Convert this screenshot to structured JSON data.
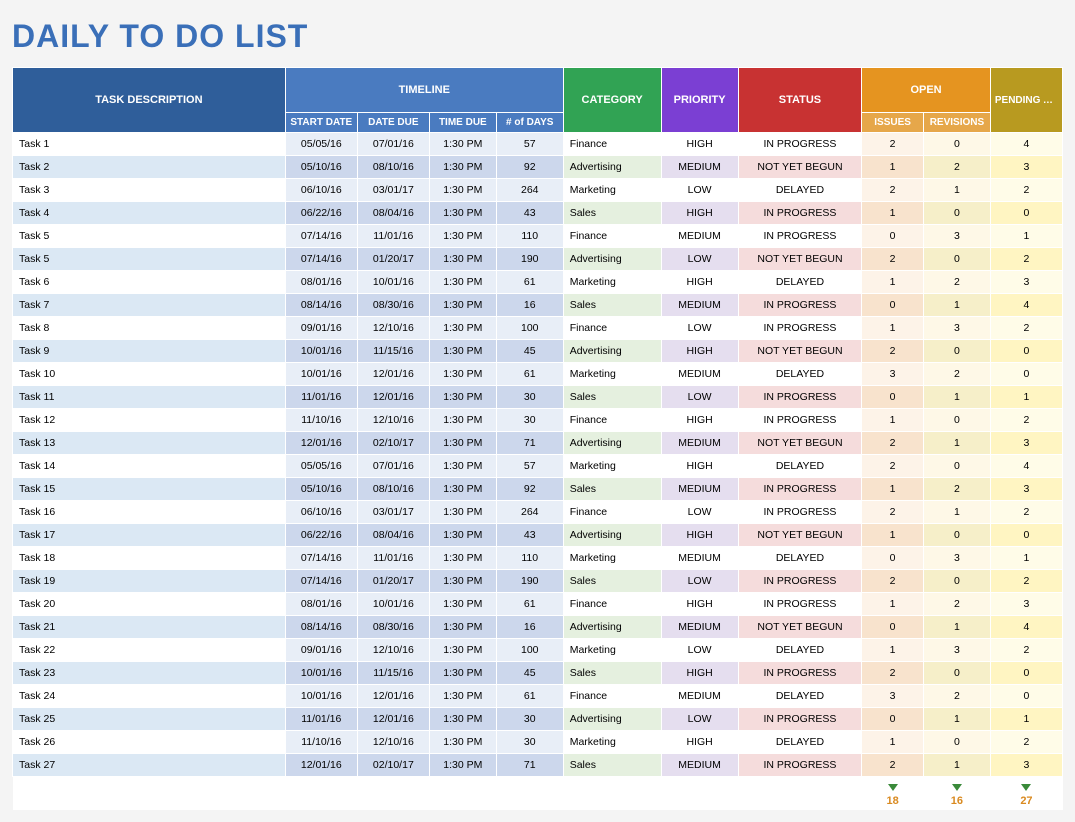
{
  "title": "DAILY TO DO LIST",
  "headers": {
    "task": "TASK DESCRIPTION",
    "timeline": "TIMELINE",
    "start": "START DATE",
    "due": "DATE DUE",
    "time": "TIME DUE",
    "days": "# of DAYS",
    "category": "CATEGORY",
    "priority": "PRIORITY",
    "status": "STATUS",
    "open": "OPEN",
    "issues": "ISSUES",
    "revisions": "REVISIONS",
    "pending": "PENDING ACTIONS"
  },
  "rows": [
    {
      "desc": "Task 1",
      "start": "05/05/16",
      "due": "07/01/16",
      "time": "1:30 PM",
      "days": "57",
      "cat": "Finance",
      "pri": "HIGH",
      "stat": "IN PROGRESS",
      "iss": "2",
      "rev": "0",
      "pend": "4"
    },
    {
      "desc": "Task 2",
      "start": "05/10/16",
      "due": "08/10/16",
      "time": "1:30 PM",
      "days": "92",
      "cat": "Advertising",
      "pri": "MEDIUM",
      "stat": "NOT YET BEGUN",
      "iss": "1",
      "rev": "2",
      "pend": "3"
    },
    {
      "desc": "Task 3",
      "start": "06/10/16",
      "due": "03/01/17",
      "time": "1:30 PM",
      "days": "264",
      "cat": "Marketing",
      "pri": "LOW",
      "stat": "DELAYED",
      "iss": "2",
      "rev": "1",
      "pend": "2"
    },
    {
      "desc": "Task 4",
      "start": "06/22/16",
      "due": "08/04/16",
      "time": "1:30 PM",
      "days": "43",
      "cat": "Sales",
      "pri": "HIGH",
      "stat": "IN PROGRESS",
      "iss": "1",
      "rev": "0",
      "pend": "0"
    },
    {
      "desc": "Task 5",
      "start": "07/14/16",
      "due": "11/01/16",
      "time": "1:30 PM",
      "days": "110",
      "cat": "Finance",
      "pri": "MEDIUM",
      "stat": "IN PROGRESS",
      "iss": "0",
      "rev": "3",
      "pend": "1"
    },
    {
      "desc": "Task 5",
      "start": "07/14/16",
      "due": "01/20/17",
      "time": "1:30 PM",
      "days": "190",
      "cat": "Advertising",
      "pri": "LOW",
      "stat": "NOT YET BEGUN",
      "iss": "2",
      "rev": "0",
      "pend": "2"
    },
    {
      "desc": "Task 6",
      "start": "08/01/16",
      "due": "10/01/16",
      "time": "1:30 PM",
      "days": "61",
      "cat": "Marketing",
      "pri": "HIGH",
      "stat": "DELAYED",
      "iss": "1",
      "rev": "2",
      "pend": "3"
    },
    {
      "desc": "Task 7",
      "start": "08/14/16",
      "due": "08/30/16",
      "time": "1:30 PM",
      "days": "16",
      "cat": "Sales",
      "pri": "MEDIUM",
      "stat": "IN PROGRESS",
      "iss": "0",
      "rev": "1",
      "pend": "4"
    },
    {
      "desc": "Task 8",
      "start": "09/01/16",
      "due": "12/10/16",
      "time": "1:30 PM",
      "days": "100",
      "cat": "Finance",
      "pri": "LOW",
      "stat": "IN PROGRESS",
      "iss": "1",
      "rev": "3",
      "pend": "2"
    },
    {
      "desc": "Task 9",
      "start": "10/01/16",
      "due": "11/15/16",
      "time": "1:30 PM",
      "days": "45",
      "cat": "Advertising",
      "pri": "HIGH",
      "stat": "NOT YET BEGUN",
      "iss": "2",
      "rev": "0",
      "pend": "0"
    },
    {
      "desc": "Task 10",
      "start": "10/01/16",
      "due": "12/01/16",
      "time": "1:30 PM",
      "days": "61",
      "cat": "Marketing",
      "pri": "MEDIUM",
      "stat": "DELAYED",
      "iss": "3",
      "rev": "2",
      "pend": "0"
    },
    {
      "desc": "Task 11",
      "start": "11/01/16",
      "due": "12/01/16",
      "time": "1:30 PM",
      "days": "30",
      "cat": "Sales",
      "pri": "LOW",
      "stat": "IN PROGRESS",
      "iss": "0",
      "rev": "1",
      "pend": "1"
    },
    {
      "desc": "Task 12",
      "start": "11/10/16",
      "due": "12/10/16",
      "time": "1:30 PM",
      "days": "30",
      "cat": "Finance",
      "pri": "HIGH",
      "stat": "IN PROGRESS",
      "iss": "1",
      "rev": "0",
      "pend": "2"
    },
    {
      "desc": "Task 13",
      "start": "12/01/16",
      "due": "02/10/17",
      "time": "1:30 PM",
      "days": "71",
      "cat": "Advertising",
      "pri": "MEDIUM",
      "stat": "NOT YET BEGUN",
      "iss": "2",
      "rev": "1",
      "pend": "3"
    },
    {
      "desc": "Task 14",
      "start": "05/05/16",
      "due": "07/01/16",
      "time": "1:30 PM",
      "days": "57",
      "cat": "Marketing",
      "pri": "HIGH",
      "stat": "DELAYED",
      "iss": "2",
      "rev": "0",
      "pend": "4"
    },
    {
      "desc": "Task 15",
      "start": "05/10/16",
      "due": "08/10/16",
      "time": "1:30 PM",
      "days": "92",
      "cat": "Sales",
      "pri": "MEDIUM",
      "stat": "IN PROGRESS",
      "iss": "1",
      "rev": "2",
      "pend": "3"
    },
    {
      "desc": "Task 16",
      "start": "06/10/16",
      "due": "03/01/17",
      "time": "1:30 PM",
      "days": "264",
      "cat": "Finance",
      "pri": "LOW",
      "stat": "IN PROGRESS",
      "iss": "2",
      "rev": "1",
      "pend": "2"
    },
    {
      "desc": "Task 17",
      "start": "06/22/16",
      "due": "08/04/16",
      "time": "1:30 PM",
      "days": "43",
      "cat": "Advertising",
      "pri": "HIGH",
      "stat": "NOT YET BEGUN",
      "iss": "1",
      "rev": "0",
      "pend": "0"
    },
    {
      "desc": "Task 18",
      "start": "07/14/16",
      "due": "11/01/16",
      "time": "1:30 PM",
      "days": "110",
      "cat": "Marketing",
      "pri": "MEDIUM",
      "stat": "DELAYED",
      "iss": "0",
      "rev": "3",
      "pend": "1"
    },
    {
      "desc": "Task 19",
      "start": "07/14/16",
      "due": "01/20/17",
      "time": "1:30 PM",
      "days": "190",
      "cat": "Sales",
      "pri": "LOW",
      "stat": "IN PROGRESS",
      "iss": "2",
      "rev": "0",
      "pend": "2"
    },
    {
      "desc": "Task 20",
      "start": "08/01/16",
      "due": "10/01/16",
      "time": "1:30 PM",
      "days": "61",
      "cat": "Finance",
      "pri": "HIGH",
      "stat": "IN PROGRESS",
      "iss": "1",
      "rev": "2",
      "pend": "3"
    },
    {
      "desc": "Task 21",
      "start": "08/14/16",
      "due": "08/30/16",
      "time": "1:30 PM",
      "days": "16",
      "cat": "Advertising",
      "pri": "MEDIUM",
      "stat": "NOT YET BEGUN",
      "iss": "0",
      "rev": "1",
      "pend": "4"
    },
    {
      "desc": "Task 22",
      "start": "09/01/16",
      "due": "12/10/16",
      "time": "1:30 PM",
      "days": "100",
      "cat": "Marketing",
      "pri": "LOW",
      "stat": "DELAYED",
      "iss": "1",
      "rev": "3",
      "pend": "2"
    },
    {
      "desc": "Task 23",
      "start": "10/01/16",
      "due": "11/15/16",
      "time": "1:30 PM",
      "days": "45",
      "cat": "Sales",
      "pri": "HIGH",
      "stat": "IN PROGRESS",
      "iss": "2",
      "rev": "0",
      "pend": "0"
    },
    {
      "desc": "Task 24",
      "start": "10/01/16",
      "due": "12/01/16",
      "time": "1:30 PM",
      "days": "61",
      "cat": "Finance",
      "pri": "MEDIUM",
      "stat": "DELAYED",
      "iss": "3",
      "rev": "2",
      "pend": "0"
    },
    {
      "desc": "Task 25",
      "start": "11/01/16",
      "due": "12/01/16",
      "time": "1:30 PM",
      "days": "30",
      "cat": "Advertising",
      "pri": "LOW",
      "stat": "IN PROGRESS",
      "iss": "0",
      "rev": "1",
      "pend": "1"
    },
    {
      "desc": "Task 26",
      "start": "11/10/16",
      "due": "12/10/16",
      "time": "1:30 PM",
      "days": "30",
      "cat": "Marketing",
      "pri": "HIGH",
      "stat": "DELAYED",
      "iss": "1",
      "rev": "0",
      "pend": "2"
    },
    {
      "desc": "Task 27",
      "start": "12/01/16",
      "due": "02/10/17",
      "time": "1:30 PM",
      "days": "71",
      "cat": "Sales",
      "pri": "MEDIUM",
      "stat": "IN PROGRESS",
      "iss": "2",
      "rev": "1",
      "pend": "3"
    }
  ],
  "totals": {
    "issues": "18",
    "revisions": "16",
    "pending": "27"
  }
}
